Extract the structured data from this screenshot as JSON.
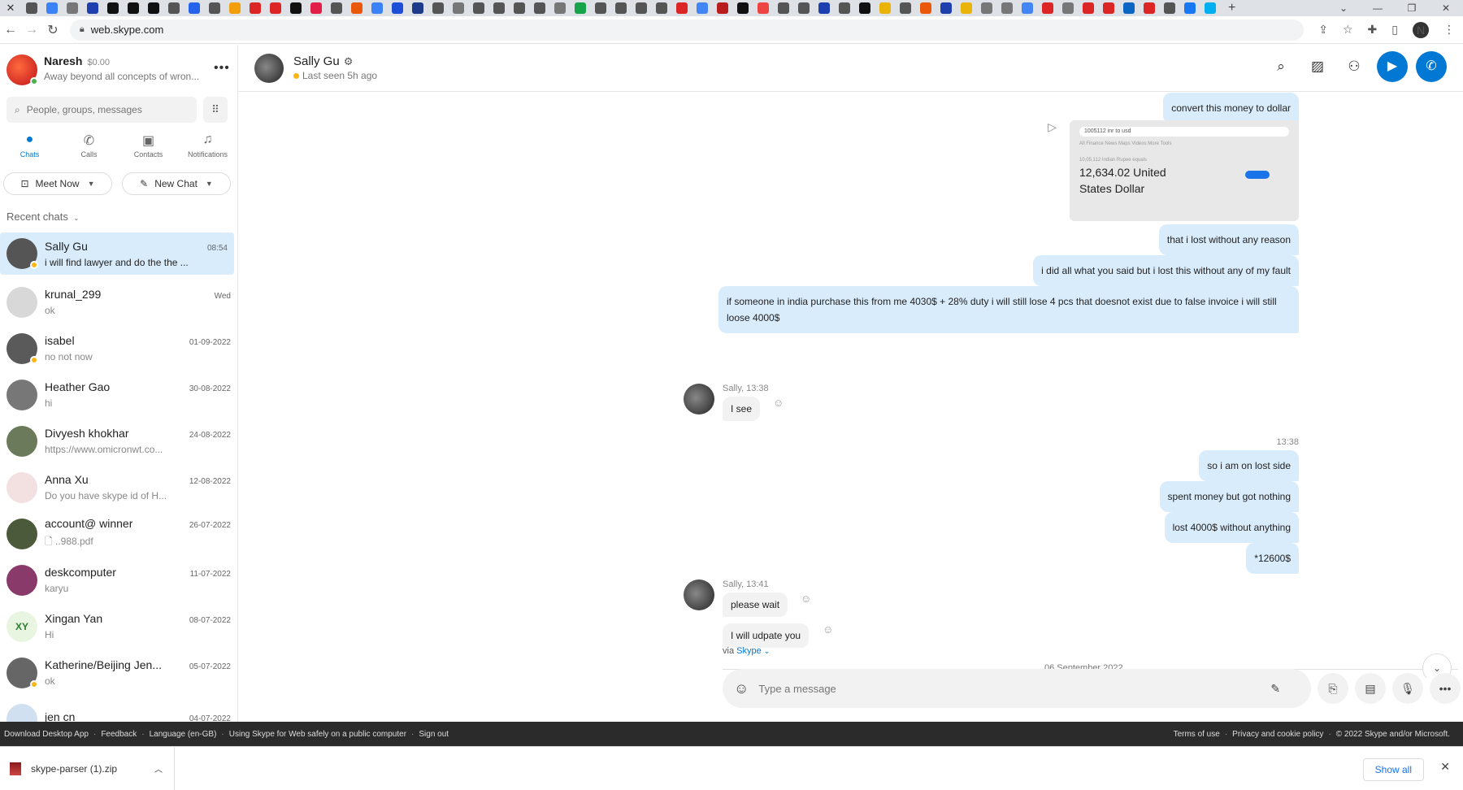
{
  "browser": {
    "url": "web.skype.com",
    "favicon_colors": [
      "#555",
      "#3b82f6",
      "#777",
      "#1e40af",
      "#111",
      "#111",
      "#111",
      "#555",
      "#2563eb",
      "#555",
      "#f59e0b",
      "#dc2626",
      "#dc2626",
      "#111",
      "#e11d48",
      "#555",
      "#ea580c",
      "#3b82f6",
      "#1d4ed8",
      "#1e3a8a",
      "#555",
      "#777",
      "#555",
      "#555",
      "#555",
      "#555",
      "#777",
      "#16a34a",
      "#555",
      "#555",
      "#555",
      "#555",
      "#dc2626",
      "#4285f4",
      "#b91c1c",
      "#111",
      "#ef4444",
      "#555",
      "#555",
      "#1e40af",
      "#555",
      "#111",
      "#eab308",
      "#555",
      "#ea580c",
      "#1e40af",
      "#eab308",
      "#777",
      "#777",
      "#4285f4",
      "#dc2626",
      "#777",
      "#dc2626",
      "#dc2626",
      "#0a66c2",
      "#dc2626",
      "#555",
      "#1877f2",
      "#00aff0"
    ],
    "new_tab": "+",
    "profile_initial": "N"
  },
  "me": {
    "name": "Naresh",
    "credit": "$0.00",
    "status": "Away beyond all concepts of wron..."
  },
  "search": {
    "placeholder": "People, groups, messages"
  },
  "nav_tabs": [
    {
      "label": "Chats",
      "icon": "chat-bubble-icon"
    },
    {
      "label": "Calls",
      "icon": "phone-icon"
    },
    {
      "label": "Contacts",
      "icon": "contacts-icon"
    },
    {
      "label": "Notifications",
      "icon": "bell-icon"
    }
  ],
  "actions": {
    "meet_now": "Meet Now",
    "new_chat": "New Chat"
  },
  "recent_label": "Recent chats",
  "chats": [
    {
      "name": "Sally Gu",
      "time": "08:54",
      "message": "i will find lawyer and do the the ...",
      "avatar_color": "#555",
      "initials": ""
    },
    {
      "name": "krunal_299",
      "time": "Wed",
      "message": "ok",
      "avatar_color": "#d8d8d8",
      "initials": ""
    },
    {
      "name": "isabel",
      "time": "01-09-2022",
      "message": "no not now",
      "avatar_color": "#5a5a5a",
      "initials": ""
    },
    {
      "name": "Heather Gao",
      "time": "30-08-2022",
      "message": "hi",
      "avatar_color": "#777",
      "initials": ""
    },
    {
      "name": "Divyesh khokhar",
      "time": "24-08-2022",
      "message": "https://www.omicronwt.co...",
      "avatar_color": "#6b7a5a",
      "initials": ""
    },
    {
      "name": "Anna Xu",
      "time": "12-08-2022",
      "message": "Do you have skype id of H...",
      "avatar_color": "#f3e0e0",
      "initials": ""
    },
    {
      "name": "account@ winner",
      "time": "26-07-2022",
      "message": "..988.pdf",
      "avatar_color": "#4b5a3a",
      "initials": ""
    },
    {
      "name": "deskcomputer",
      "time": "11-07-2022",
      "message": "karyu",
      "avatar_color": "#8a3a6a",
      "initials": ""
    },
    {
      "name": "Xingan  Yan",
      "time": "08-07-2022",
      "message": "Hi",
      "avatar_color": "#e8f5e0",
      "initials": "XY"
    },
    {
      "name": "Katherine/Beijing Jen...",
      "time": "05-07-2022",
      "message": "ok",
      "avatar_color": "#666",
      "initials": ""
    },
    {
      "name": "jen cn",
      "time": "04-07-2022",
      "message": "",
      "avatar_color": "#d0e0f0",
      "initials": ""
    }
  ],
  "conversation": {
    "name": "Sally Gu",
    "last_seen": "Last seen 5h ago",
    "image_msg": {
      "query": "1005112 inr to usd",
      "tabs": "All   Finance   News   Maps   Videos   More          Tools",
      "sub": "10,05,112 Indian Rupee equals",
      "result": "12,634.02 United States Dollar"
    },
    "messages_out_1": [
      "convert this money to dollar",
      "that i lost without any reason",
      "i did all what you said but i lost this without any of my fault",
      "if someone in india purchase this from me 4030$ + 28% duty i will still lose 4 pcs that doesnot exist due to false invoice i will still loose 4000$"
    ],
    "in_1": {
      "sender": "Sally, 13:38",
      "text": "I see"
    },
    "out_stamp": "13:38",
    "messages_out_2": [
      "so i am on lost side",
      "spent money but got nothing",
      "lost 4000$ without anything",
      "*12600$"
    ],
    "in_2": {
      "sender": "Sally, 13:41",
      "texts": [
        "please wait",
        "I will udpate you"
      ]
    },
    "date_divider": "06 September 2022",
    "via": "via",
    "via_link": "Skype",
    "composer_placeholder": "Type a message"
  },
  "footer": {
    "left": [
      "Download Desktop App",
      "Feedback",
      "Language (en-GB)",
      "Using Skype for Web safely on a public computer",
      "Sign out"
    ],
    "right": [
      "Terms of use",
      "Privacy and cookie policy",
      "© 2022 Skype and/or Microsoft."
    ]
  },
  "downloads": {
    "file": "skype-parser (1).zip",
    "show_all": "Show all"
  }
}
